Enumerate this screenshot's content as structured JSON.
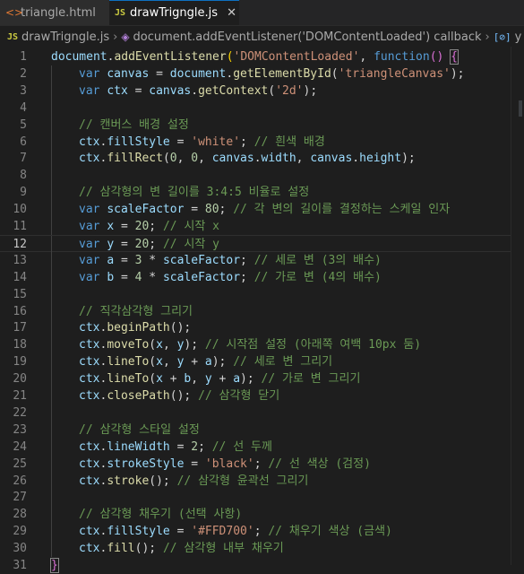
{
  "tabs": [
    {
      "label": "triangle.html",
      "icon": "html-file-icon",
      "active": false
    },
    {
      "label": "drawTrigngle.js",
      "icon": "js-file-icon",
      "active": true,
      "close": "✕"
    }
  ],
  "js_icon_text": "JS",
  "breadcrumb": {
    "file": "drawTrigngle.js",
    "scope": "document.addEventListener('DOMContentLoaded') callback",
    "symbol": "y",
    "symbol_icon": "[⊘]"
  },
  "editor": {
    "current_line": 12,
    "lines": [
      {
        "n": "1",
        "indent": 0,
        "code": [
          [
            "t-var",
            "document"
          ],
          [
            "t-op",
            "."
          ],
          [
            "t-fn",
            "addEventListener"
          ],
          [
            "t-br",
            "("
          ],
          [
            "t-str",
            "'DOMContentLoaded'"
          ],
          [
            "t-op",
            ", "
          ],
          [
            "t-kw",
            "function"
          ],
          [
            "t-br2",
            "()"
          ],
          [
            "t-op",
            " "
          ],
          [
            "t-br2 bracket-box",
            "{"
          ]
        ]
      },
      {
        "n": "2",
        "indent": 1,
        "code": [
          [
            "t-kw",
            "var "
          ],
          [
            "t-var",
            "canvas"
          ],
          [
            "t-op",
            " = "
          ],
          [
            "t-var",
            "document"
          ],
          [
            "t-op",
            "."
          ],
          [
            "t-fn",
            "getElementById"
          ],
          [
            "t-op",
            "("
          ],
          [
            "t-str",
            "'triangleCanvas'"
          ],
          [
            "t-op",
            ");"
          ]
        ]
      },
      {
        "n": "3",
        "indent": 1,
        "code": [
          [
            "t-kw",
            "var "
          ],
          [
            "t-var",
            "ctx"
          ],
          [
            "t-op",
            " = "
          ],
          [
            "t-var",
            "canvas"
          ],
          [
            "t-op",
            "."
          ],
          [
            "t-fn",
            "getContext"
          ],
          [
            "t-op",
            "("
          ],
          [
            "t-str",
            "'2d'"
          ],
          [
            "t-op",
            ");"
          ]
        ]
      },
      {
        "n": "4",
        "indent": 1,
        "code": []
      },
      {
        "n": "5",
        "indent": 1,
        "code": [
          [
            "t-cm",
            "// 캔버스 배경 설정"
          ]
        ]
      },
      {
        "n": "6",
        "indent": 1,
        "code": [
          [
            "t-var",
            "ctx"
          ],
          [
            "t-op",
            "."
          ],
          [
            "t-var",
            "fillStyle"
          ],
          [
            "t-op",
            " = "
          ],
          [
            "t-str",
            "'white'"
          ],
          [
            "t-op",
            "; "
          ],
          [
            "t-cm",
            "// 흰색 배경"
          ]
        ]
      },
      {
        "n": "7",
        "indent": 1,
        "code": [
          [
            "t-var",
            "ctx"
          ],
          [
            "t-op",
            "."
          ],
          [
            "t-fn",
            "fillRect"
          ],
          [
            "t-op",
            "("
          ],
          [
            "t-num",
            "0"
          ],
          [
            "t-op",
            ", "
          ],
          [
            "t-num",
            "0"
          ],
          [
            "t-op",
            ", "
          ],
          [
            "t-var",
            "canvas"
          ],
          [
            "t-op",
            "."
          ],
          [
            "t-var",
            "width"
          ],
          [
            "t-op",
            ", "
          ],
          [
            "t-var",
            "canvas"
          ],
          [
            "t-op",
            "."
          ],
          [
            "t-var",
            "height"
          ],
          [
            "t-op",
            ");"
          ]
        ]
      },
      {
        "n": "8",
        "indent": 1,
        "code": []
      },
      {
        "n": "9",
        "indent": 1,
        "code": [
          [
            "t-cm",
            "// 삼각형의 변 길이를 3:4:5 비율로 설정"
          ]
        ]
      },
      {
        "n": "10",
        "indent": 1,
        "code": [
          [
            "t-kw",
            "var "
          ],
          [
            "t-var",
            "scaleFactor"
          ],
          [
            "t-op",
            " = "
          ],
          [
            "t-num",
            "80"
          ],
          [
            "t-op",
            "; "
          ],
          [
            "t-cm",
            "// 각 변의 길이를 결정하는 스케일 인자"
          ]
        ]
      },
      {
        "n": "11",
        "indent": 1,
        "code": [
          [
            "t-kw",
            "var "
          ],
          [
            "t-var",
            "x"
          ],
          [
            "t-op",
            " = "
          ],
          [
            "t-num",
            "20"
          ],
          [
            "t-op",
            "; "
          ],
          [
            "t-cm",
            "// 시작 x"
          ]
        ]
      },
      {
        "n": "12",
        "indent": 1,
        "code": [
          [
            "t-kw",
            "var "
          ],
          [
            "t-var",
            "y"
          ],
          [
            "t-op",
            " = "
          ],
          [
            "t-num",
            "20"
          ],
          [
            "t-op",
            "; "
          ],
          [
            "t-cm",
            "// 시작 y"
          ]
        ]
      },
      {
        "n": "13",
        "indent": 1,
        "code": [
          [
            "t-kw",
            "var "
          ],
          [
            "t-var",
            "a"
          ],
          [
            "t-op",
            " = "
          ],
          [
            "t-num",
            "3"
          ],
          [
            "t-op",
            " * "
          ],
          [
            "t-var",
            "scaleFactor"
          ],
          [
            "t-op",
            "; "
          ],
          [
            "t-cm",
            "// 세로 변 (3의 배수)"
          ]
        ]
      },
      {
        "n": "14",
        "indent": 1,
        "code": [
          [
            "t-kw",
            "var "
          ],
          [
            "t-var",
            "b"
          ],
          [
            "t-op",
            " = "
          ],
          [
            "t-num",
            "4"
          ],
          [
            "t-op",
            " * "
          ],
          [
            "t-var",
            "scaleFactor"
          ],
          [
            "t-op",
            "; "
          ],
          [
            "t-cm",
            "// 가로 변 (4의 배수)"
          ]
        ]
      },
      {
        "n": "15",
        "indent": 1,
        "code": []
      },
      {
        "n": "16",
        "indent": 1,
        "code": [
          [
            "t-cm",
            "// 직각삼각형 그리기"
          ]
        ]
      },
      {
        "n": "17",
        "indent": 1,
        "code": [
          [
            "t-var",
            "ctx"
          ],
          [
            "t-op",
            "."
          ],
          [
            "t-fn",
            "beginPath"
          ],
          [
            "t-op",
            "();"
          ]
        ]
      },
      {
        "n": "18",
        "indent": 1,
        "code": [
          [
            "t-var",
            "ctx"
          ],
          [
            "t-op",
            "."
          ],
          [
            "t-fn",
            "moveTo"
          ],
          [
            "t-op",
            "("
          ],
          [
            "t-var",
            "x"
          ],
          [
            "t-op",
            ", "
          ],
          [
            "t-var",
            "y"
          ],
          [
            "t-op",
            "); "
          ],
          [
            "t-cm",
            "// 시작점 설정 (아래쪽 여백 10px 둠)"
          ]
        ]
      },
      {
        "n": "19",
        "indent": 1,
        "code": [
          [
            "t-var",
            "ctx"
          ],
          [
            "t-op",
            "."
          ],
          [
            "t-fn",
            "lineTo"
          ],
          [
            "t-op",
            "("
          ],
          [
            "t-var",
            "x"
          ],
          [
            "t-op",
            ", "
          ],
          [
            "t-var",
            "y"
          ],
          [
            "t-op",
            " + "
          ],
          [
            "t-var",
            "a"
          ],
          [
            "t-op",
            "); "
          ],
          [
            "t-cm",
            "// 세로 변 그리기"
          ]
        ]
      },
      {
        "n": "20",
        "indent": 1,
        "code": [
          [
            "t-var",
            "ctx"
          ],
          [
            "t-op",
            "."
          ],
          [
            "t-fn",
            "lineTo"
          ],
          [
            "t-op",
            "("
          ],
          [
            "t-var",
            "x"
          ],
          [
            "t-op",
            " + "
          ],
          [
            "t-var",
            "b"
          ],
          [
            "t-op",
            ", "
          ],
          [
            "t-var",
            "y"
          ],
          [
            "t-op",
            " + "
          ],
          [
            "t-var",
            "a"
          ],
          [
            "t-op",
            "); "
          ],
          [
            "t-cm",
            "// 가로 변 그리기"
          ]
        ]
      },
      {
        "n": "21",
        "indent": 1,
        "code": [
          [
            "t-var",
            "ctx"
          ],
          [
            "t-op",
            "."
          ],
          [
            "t-fn",
            "closePath"
          ],
          [
            "t-op",
            "(); "
          ],
          [
            "t-cm",
            "// 삼각형 닫기"
          ]
        ]
      },
      {
        "n": "22",
        "indent": 1,
        "code": []
      },
      {
        "n": "23",
        "indent": 1,
        "code": [
          [
            "t-cm",
            "// 삼각형 스타일 설정"
          ]
        ]
      },
      {
        "n": "24",
        "indent": 1,
        "code": [
          [
            "t-var",
            "ctx"
          ],
          [
            "t-op",
            "."
          ],
          [
            "t-var",
            "lineWidth"
          ],
          [
            "t-op",
            " = "
          ],
          [
            "t-num",
            "2"
          ],
          [
            "t-op",
            "; "
          ],
          [
            "t-cm",
            "// 선 두께"
          ]
        ]
      },
      {
        "n": "25",
        "indent": 1,
        "code": [
          [
            "t-var",
            "ctx"
          ],
          [
            "t-op",
            "."
          ],
          [
            "t-var",
            "strokeStyle"
          ],
          [
            "t-op",
            " = "
          ],
          [
            "t-str",
            "'black'"
          ],
          [
            "t-op",
            "; "
          ],
          [
            "t-cm",
            "// 선 색상 (검정)"
          ]
        ]
      },
      {
        "n": "26",
        "indent": 1,
        "code": [
          [
            "t-var",
            "ctx"
          ],
          [
            "t-op",
            "."
          ],
          [
            "t-fn",
            "stroke"
          ],
          [
            "t-op",
            "(); "
          ],
          [
            "t-cm",
            "// 삼각형 윤곽선 그리기"
          ]
        ]
      },
      {
        "n": "27",
        "indent": 1,
        "code": []
      },
      {
        "n": "28",
        "indent": 1,
        "code": [
          [
            "t-cm",
            "// 삼각형 채우기 (선택 사항)"
          ]
        ]
      },
      {
        "n": "29",
        "indent": 1,
        "code": [
          [
            "t-var",
            "ctx"
          ],
          [
            "t-op",
            "."
          ],
          [
            "t-var",
            "fillStyle"
          ],
          [
            "t-op",
            " = "
          ],
          [
            "t-str",
            "'#FFD700'"
          ],
          [
            "t-op",
            "; "
          ],
          [
            "t-cm",
            "// 채우기 색상 (금색)"
          ]
        ]
      },
      {
        "n": "30",
        "indent": 1,
        "code": [
          [
            "t-var",
            "ctx"
          ],
          [
            "t-op",
            "."
          ],
          [
            "t-fn",
            "fill"
          ],
          [
            "t-op",
            "(); "
          ],
          [
            "t-cm",
            "// 삼각형 내부 채우기"
          ]
        ]
      },
      {
        "n": "31",
        "indent": 0,
        "code": [
          [
            "t-br2 bracket-box",
            "}"
          ]
        ]
      }
    ]
  },
  "colors": {
    "background": "#1e1e1e",
    "tab_bar": "#252526",
    "accent": "#0e70c0"
  }
}
